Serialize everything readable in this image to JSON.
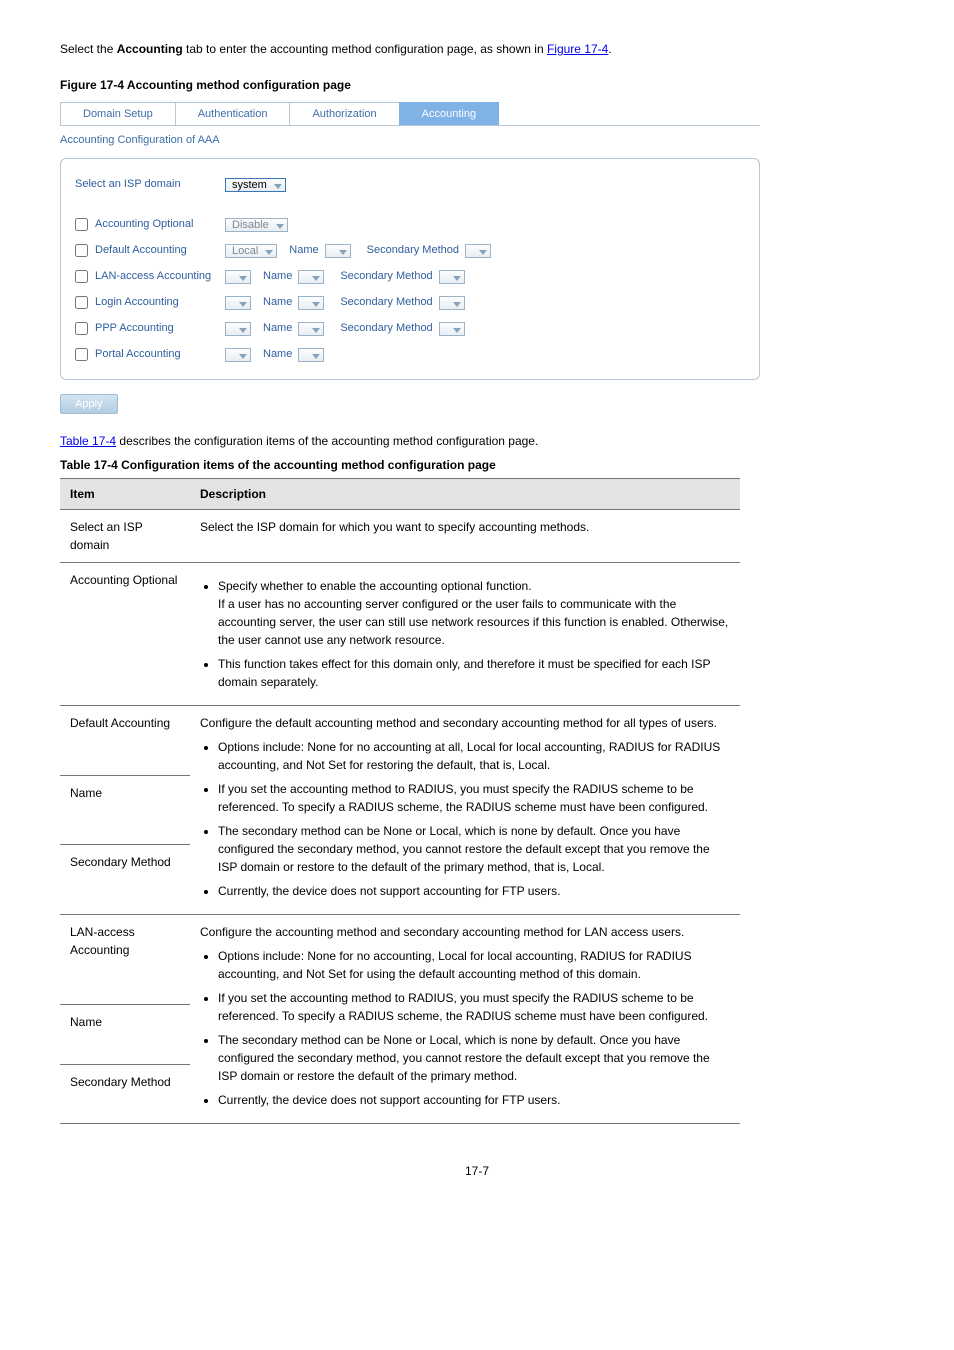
{
  "intro": {
    "text_before": "Select the ",
    "tab_bold": "Accounting",
    "text_mid": " tab to enter the accounting method configuration page, as shown in ",
    "fig_link": "Figure 17-4",
    "text_after": "."
  },
  "figure4_label": "Figure 17-4 Accounting method configuration page",
  "panel": {
    "tabs": {
      "domain": "Domain Setup",
      "auth": "Authentication",
      "authz": "Authorization",
      "acct": "Accounting"
    },
    "subhead": "Accounting Configuration of AAA",
    "select_isp_label": "Select an ISP domain",
    "select_isp_value": "system",
    "rows": {
      "opt": {
        "label": "Accounting Optional",
        "sel": "Disable"
      },
      "def": {
        "label": "Default Accounting",
        "sel": "Local"
      },
      "lan": {
        "label": "LAN-access Accounting"
      },
      "login": {
        "label": "Login Accounting"
      },
      "ppp": {
        "label": "PPP Accounting"
      },
      "portal": {
        "label": "Portal Accounting"
      }
    },
    "name_label": "Name",
    "secondary_label": "Secondary Method",
    "apply": "Apply"
  },
  "desc_link_text": "Table 17-4 describes the configuration items of the accounting method configuration page.",
  "table_link": "Table 17-4",
  "table_caption": "Table 17-4 Configuration items of the accounting method configuration page",
  "table": {
    "hdr_item": "Item",
    "hdr_desc": "Description",
    "r1_item": "Select an ISP domain",
    "r1_desc": "Select the ISP domain for which you want to specify accounting methods.",
    "r2_item": "Accounting Optional",
    "r2_b1": "Specify whether to enable the accounting optional function.",
    "r2_b1b": "If a user has no accounting server configured or the user fails to communicate with the accounting server, the user can still use network resources if this function is enabled. Otherwise, the user cannot use any network resource.",
    "r2_b2": "This function takes effect for this domain only, and therefore it must be specified for each ISP domain separately.",
    "r3_item": "Default Accounting",
    "r3_desc": "Configure the default accounting method and secondary accounting method for all types of users.",
    "r4_item": "Name",
    "r5_item": "Secondary Method",
    "r345_b1": "Options include: None for no accounting at all, Local for local accounting, RADIUS for RADIUS accounting, and Not Set for restoring the default, that is, Local.",
    "r345_b2": "If you set the accounting method to RADIUS, you must specify the RADIUS scheme to be referenced. To specify a RADIUS scheme, the RADIUS scheme must have been configured.",
    "r345_b3": "The secondary method can be None or Local, which is none by default. Once you have configured the secondary method, you cannot restore the default except that you remove the ISP domain or restore to the default of the primary method, that is, Local.",
    "r345_b4": "Currently, the device does not support accounting for FTP users.",
    "r6_item": "LAN-access Accounting",
    "r6_desc": "Configure the accounting method and secondary accounting method for LAN access users.",
    "r7_item": "Name",
    "r8_item": "Secondary Method",
    "r678_b1": "Options include: None for no accounting, Local for local accounting, RADIUS for RADIUS accounting, and Not Set for using the default accounting method of this domain.",
    "r678_b2": "If you set the accounting method to RADIUS, you must specify the RADIUS scheme to be referenced. To specify a RADIUS scheme, the RADIUS scheme must have been configured.",
    "r678_b3": "The secondary method can be None or Local, which is none by default. Once you have configured the secondary method, you cannot restore the default except that you remove the ISP domain or restore the default of the primary method.",
    "r678_b4": "Currently, the device does not support accounting for FTP users."
  },
  "page_number": "17-7"
}
